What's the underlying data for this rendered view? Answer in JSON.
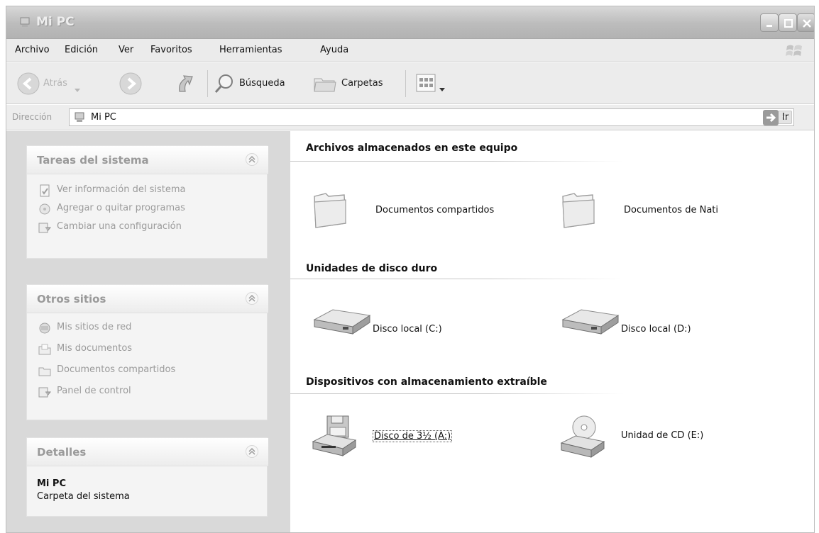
{
  "window": {
    "title": "Mi PC"
  },
  "menu": [
    {
      "label": "Archivo"
    },
    {
      "label": "Edición"
    },
    {
      "label": "Ver"
    },
    {
      "label": "Favoritos"
    },
    {
      "label": "Herramientas"
    },
    {
      "label": "Ayuda"
    }
  ],
  "toolbar": {
    "back_label": "Atrás",
    "search_label": "Búsqueda",
    "folders_label": "Carpetas"
  },
  "address": {
    "label": "Dirección",
    "value": "Mi PC",
    "go_label": "Ir"
  },
  "taskpane": {
    "system_tasks": {
      "title": "Tareas del sistema",
      "items": [
        {
          "label": "Ver información del sistema",
          "icon": "system-info-icon"
        },
        {
          "label": "Agregar o quitar programas",
          "icon": "add-remove-programs-icon"
        },
        {
          "label": "Cambiar una configuración",
          "icon": "control-panel-icon"
        }
      ]
    },
    "other_places": {
      "title": "Otros sitios",
      "items": [
        {
          "label": "Mis sitios de red",
          "icon": "network-places-icon"
        },
        {
          "label": "Mis documentos",
          "icon": "my-documents-icon"
        },
        {
          "label": "Documentos compartidos",
          "icon": "shared-folder-icon"
        },
        {
          "label": "Panel de control",
          "icon": "control-panel-icon"
        }
      ]
    },
    "details": {
      "title": "Detalles",
      "name": "Mi PC",
      "description": "Carpeta del sistema"
    }
  },
  "content": {
    "groups": [
      {
        "title": "Archivos almacenados en este equipo",
        "items": [
          {
            "label": "Documentos compartidos",
            "icon": "folder-icon"
          },
          {
            "label": "Documentos de Nati",
            "icon": "folder-icon"
          }
        ]
      },
      {
        "title": "Unidades de disco duro",
        "items": [
          {
            "label": "Disco local (C:)",
            "icon": "hard-drive-icon"
          },
          {
            "label": "Disco local (D:)",
            "icon": "hard-drive-icon"
          }
        ]
      },
      {
        "title": "Dispositivos con almacenamiento extraíble",
        "items": [
          {
            "label": "Disco de 3½ (A:)",
            "icon": "floppy-drive-icon",
            "focused": true
          },
          {
            "label": "Unidad de CD (E:)",
            "icon": "cd-drive-icon"
          }
        ]
      }
    ]
  }
}
